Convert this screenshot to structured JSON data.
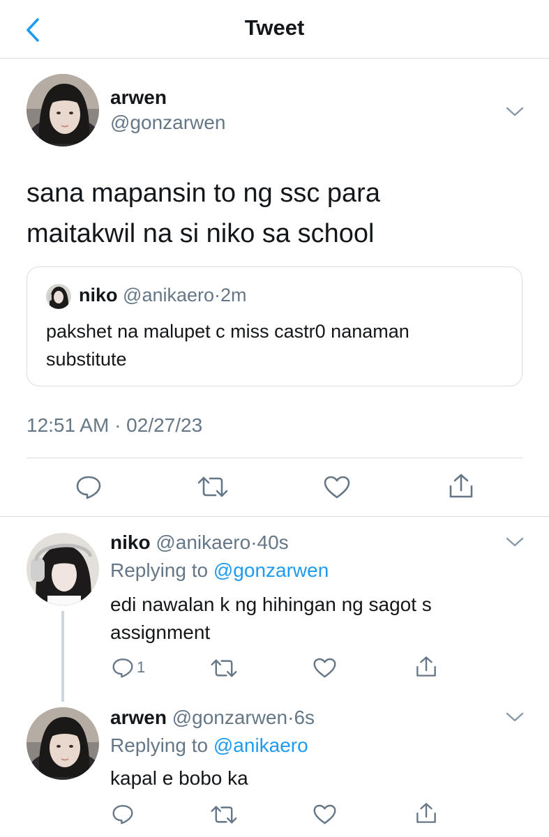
{
  "header": {
    "title": "Tweet",
    "back_icon": "chevron-left-icon",
    "accent": "#1d9bf0"
  },
  "main_tweet": {
    "author_name": "arwen",
    "author_handle": "@gonzarwen",
    "text_line1": "sana mapansin to ng ssc para",
    "text_line2": "maitakwil na si niko sa school",
    "quoted": {
      "author_name": "niko",
      "author_handle": "@anikaero",
      "separator": "·",
      "time": "2m",
      "text_line1": "pakshet na malupet c miss castr0 nanaman",
      "text_line2": "substitute"
    },
    "timestamp": "12:51 AM · 02/27/23",
    "actions": [
      "reply-icon",
      "retweet-icon",
      "like-icon",
      "share-icon"
    ]
  },
  "replies": [
    {
      "author_name": "niko",
      "author_handle": "@anikaero",
      "separator": "·",
      "time": "40s",
      "replying_prefix": "Replying to",
      "replying_to": "@gonzarwen",
      "text_line1": "edi nawalan k ng hihingan ng sagot s",
      "text_line2": "assignment",
      "reply_count": "1"
    },
    {
      "author_name": "arwen",
      "author_handle": "@gonzarwen",
      "separator": "·",
      "time": "6s",
      "replying_prefix": "Replying to",
      "replying_to": "@anikaero",
      "text_line1": "kapal e bobo ka",
      "reply_count": ""
    }
  ],
  "colors": {
    "text": "#14171a",
    "muted": "#657786",
    "link": "#1d9bf0",
    "border": "#d9dde1"
  }
}
